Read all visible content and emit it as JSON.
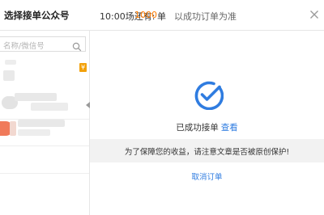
{
  "header": {
    "title": "选择接单公众号",
    "quota_label": "10:00场还有:",
    "quota_count": "1000",
    "quota_unit": "单",
    "quota_note": "以成功订单为准",
    "close_icon": "close-icon"
  },
  "sidebar": {
    "search": {
      "placeholder": "名称/微信号",
      "icon": "search-icon"
    },
    "accounts": [
      {
        "badge": "¥"
      },
      {},
      {}
    ]
  },
  "main": {
    "status_text": "已成功接单",
    "view_link": "查看",
    "notice": "为了保障您的收益，请注意文章是否被原创保护!",
    "cancel_link": "取消订单"
  },
  "colors": {
    "accent": "#2f7ce0",
    "count": "#ff7b00",
    "badge": "#f2a10a"
  }
}
